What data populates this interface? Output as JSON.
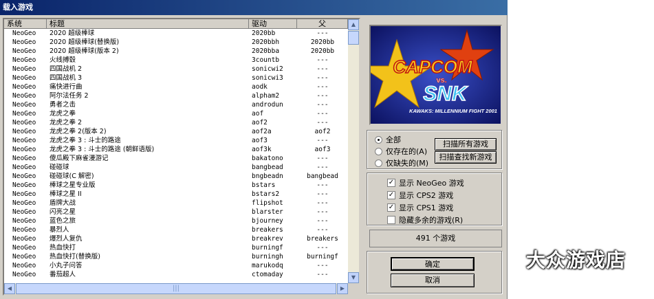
{
  "window": {
    "title": "载入游戏"
  },
  "list": {
    "columns": [
      "系统",
      "标题",
      "驱动",
      "父"
    ],
    "rows": [
      [
        "NeoGeo",
        "2020 超级棒球",
        "2020bb",
        "---"
      ],
      [
        "NeoGeo",
        "2020 超级棒球(替换版)",
        "2020bbh",
        "2020bb"
      ],
      [
        "NeoGeo",
        "2020 超级棒球(版本 2)",
        "2020bba",
        "2020bb"
      ],
      [
        "NeoGeo",
        "火线搏毂",
        "3countb",
        "---"
      ],
      [
        "NeoGeo",
        "四国战机 2",
        "sonicwi2",
        "---"
      ],
      [
        "NeoGeo",
        "四国战机 3",
        "sonicwi3",
        "---"
      ],
      [
        "NeoGeo",
        "痛快进行曲",
        "aodk",
        "---"
      ],
      [
        "NeoGeo",
        "阿尔法任务 2",
        "alpham2",
        "---"
      ],
      [
        "NeoGeo",
        "勇者之击",
        "androdun",
        "---"
      ],
      [
        "NeoGeo",
        "龙虎之拳",
        "aof",
        "---"
      ],
      [
        "NeoGeo",
        "龙虎之拳 2",
        "aof2",
        "---"
      ],
      [
        "NeoGeo",
        "龙虎之拳 2(版本 2)",
        "aof2a",
        "aof2"
      ],
      [
        "NeoGeo",
        "龙虎之拳 3 : 斗士的路途",
        "aof3",
        "---"
      ],
      [
        "NeoGeo",
        "龙虎之拳 3 : 斗士的路途 (朝鲜语版)",
        "aof3k",
        "aof3"
      ],
      [
        "NeoGeo",
        "傻瓜殿下麻雀漫游记",
        "bakatono",
        "---"
      ],
      [
        "NeoGeo",
        "碰碰球",
        "bangbead",
        "---"
      ],
      [
        "NeoGeo",
        "碰碰球(C 解密)",
        "bngbeadn",
        "bangbead"
      ],
      [
        "NeoGeo",
        "棒球之星专业版",
        "bstars",
        "---"
      ],
      [
        "NeoGeo",
        "棒球之星 II",
        "bstars2",
        "---"
      ],
      [
        "NeoGeo",
        "盾牌大战",
        "flipshot",
        "---"
      ],
      [
        "NeoGeo",
        "闪亮之星",
        "blarster",
        "---"
      ],
      [
        "NeoGeo",
        "蓝色之旅",
        "bjourney",
        "---"
      ],
      [
        "NeoGeo",
        "暴烈人",
        "breakers",
        "---"
      ],
      [
        "NeoGeo",
        "爆烈人复仇",
        "breakrev",
        "breakers"
      ],
      [
        "NeoGeo",
        "热血快打",
        "burningf",
        "---"
      ],
      [
        "NeoGeo",
        "热血快打(替换版)",
        "burningh",
        "burningf"
      ],
      [
        "NeoGeo",
        "小丸子问答",
        "marukodq",
        "---"
      ],
      [
        "NeoGeo",
        "番茄超人",
        "ctomaday",
        "---"
      ]
    ]
  },
  "preview": {
    "logo_top": "CAPCOM",
    "logo_vs": "vs.",
    "logo_bottom": "SNK",
    "logo_sub": "KAWAKS: MILLENNIUM FIGHT 2001"
  },
  "filter": {
    "options": [
      "全部",
      "仅存在的(A)",
      "仅缺失的(M)"
    ],
    "selected": 0,
    "scan_all": "扫描所有游戏",
    "scan_new": "扫描查找新游戏"
  },
  "display": {
    "options": [
      {
        "label": "显示 NeoGeo 游戏",
        "checked": true
      },
      {
        "label": "显示 CPS2 游戏",
        "checked": true
      },
      {
        "label": "显示 CPS1 游戏",
        "checked": true
      },
      {
        "label": "隐藏多余的游戏(R)",
        "checked": false
      }
    ]
  },
  "status": {
    "count_text": "491 个游戏"
  },
  "buttons": {
    "ok": "确定",
    "cancel": "取消"
  },
  "watermark": "大众游戏店"
}
